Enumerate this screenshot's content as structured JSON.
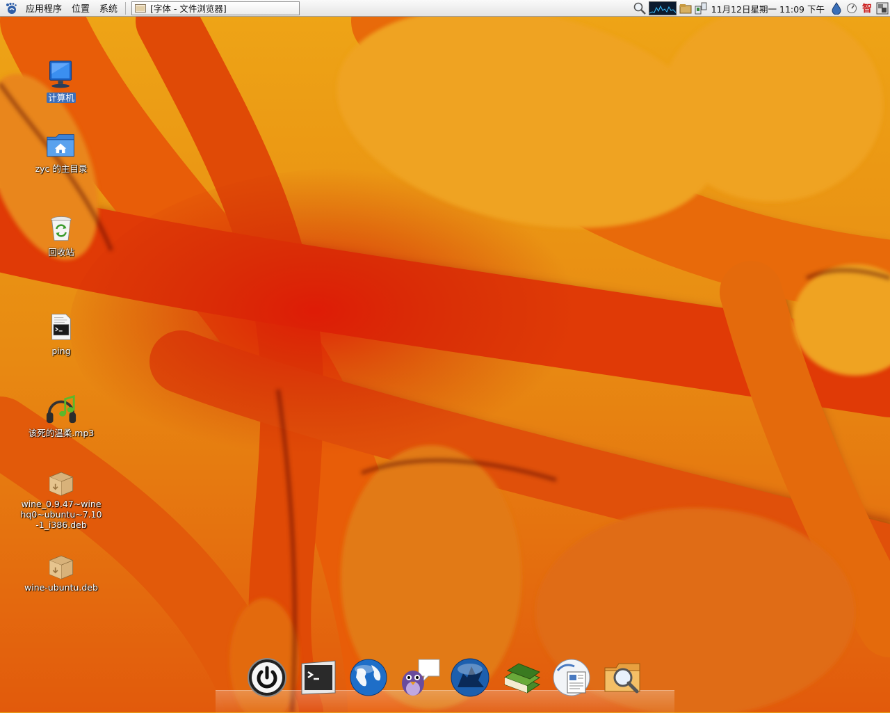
{
  "panel": {
    "menus": [
      "应用程序",
      "位置",
      "系统"
    ],
    "window_button": "[字体 - 文件浏览器]",
    "clock": "11月12日星期一 11:09 下午",
    "ime_label": "智"
  },
  "desktop": {
    "icons": [
      {
        "label": "计算机",
        "icon": "computer-icon",
        "selected": true
      },
      {
        "label": "zyc 的主目录",
        "icon": "home-folder-icon"
      },
      {
        "label": "回收站",
        "icon": "trash-icon"
      },
      {
        "label": "ping",
        "icon": "script-file-icon"
      },
      {
        "label": "该死的温柔.mp3",
        "icon": "audio-file-icon"
      },
      {
        "label": "wine_0.9.47~winehq0~ubuntu~7.10-1_i386.deb",
        "icon": "package-icon"
      },
      {
        "label": "wine-ubuntu.deb",
        "icon": "package-icon"
      }
    ]
  },
  "dock": {
    "items": [
      "power-icon",
      "terminal-icon",
      "web-browser-icon",
      "pidgin-icon",
      "wolf-app-icon",
      "books-icon",
      "office-document-icon",
      "search-folder-icon"
    ]
  },
  "colors": {
    "panel_bg": "#ececec",
    "selection": "#3e6fb8",
    "wallpaper_base": "#e9a21a",
    "wallpaper_red": "#d81e08"
  }
}
